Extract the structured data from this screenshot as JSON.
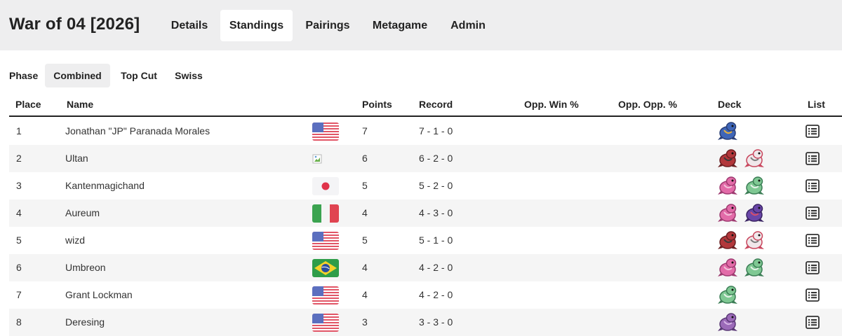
{
  "header": {
    "title": "War of 04 [2026]",
    "tabs": [
      {
        "label": "Details"
      },
      {
        "label": "Standings",
        "active": true
      },
      {
        "label": "Pairings"
      },
      {
        "label": "Metagame"
      },
      {
        "label": "Admin"
      }
    ]
  },
  "phase": {
    "label": "Phase",
    "options": [
      {
        "label": "Combined",
        "active": true
      },
      {
        "label": "Top Cut"
      },
      {
        "label": "Swiss"
      }
    ]
  },
  "table": {
    "columns": {
      "place": "Place",
      "name": "Name",
      "points": "Points",
      "record": "Record",
      "opp_win": "Opp. Win %",
      "opp_opp": "Opp. Opp. %",
      "deck": "Deck",
      "list": "List"
    },
    "rows": [
      {
        "place": "1",
        "name": "Jonathan \"JP\" Paranada Morales",
        "flag": "us",
        "points": "7",
        "record": "7 - 1 - 0",
        "deck": [
          "blue-pokemon-icon"
        ]
      },
      {
        "place": "2",
        "name": "Ultan",
        "flag": "broken",
        "points": "6",
        "record": "6 - 2 - 0",
        "deck": [
          "red-pokemon-icon",
          "white-pokemon-icon"
        ]
      },
      {
        "place": "3",
        "name": "Kantenmagichand",
        "flag": "jp",
        "points": "5",
        "record": "5 - 2 - 0",
        "deck": [
          "pink-pokemon-icon",
          "green-pokemon-icon"
        ]
      },
      {
        "place": "4",
        "name": "Aureum",
        "flag": "it",
        "points": "4",
        "record": "4 - 3 - 0",
        "deck": [
          "pink-pokemon-icon",
          "purple-pokemon-icon"
        ]
      },
      {
        "place": "5",
        "name": "wizd",
        "flag": "us",
        "points": "5",
        "record": "5 - 1 - 0",
        "deck": [
          "red-pokemon-icon",
          "white-pokemon-icon"
        ]
      },
      {
        "place": "6",
        "name": "Umbreon",
        "flag": "br",
        "points": "4",
        "record": "4 - 2 - 0",
        "deck": [
          "pink-pokemon-icon",
          "green-pokemon-icon"
        ]
      },
      {
        "place": "7",
        "name": "Grant Lockman",
        "flag": "us",
        "points": "4",
        "record": "4 - 2 - 0",
        "deck": [
          "green-pokemon-icon"
        ]
      },
      {
        "place": "8",
        "name": "Deresing",
        "flag": "us",
        "points": "3",
        "record": "3 - 3 - 0",
        "deck": [
          "violet-pokemon-icon"
        ]
      }
    ]
  },
  "colors": {
    "header_bg": "#eeeeef",
    "stripe_bg": "#f5f5f5",
    "text": "#212529"
  }
}
